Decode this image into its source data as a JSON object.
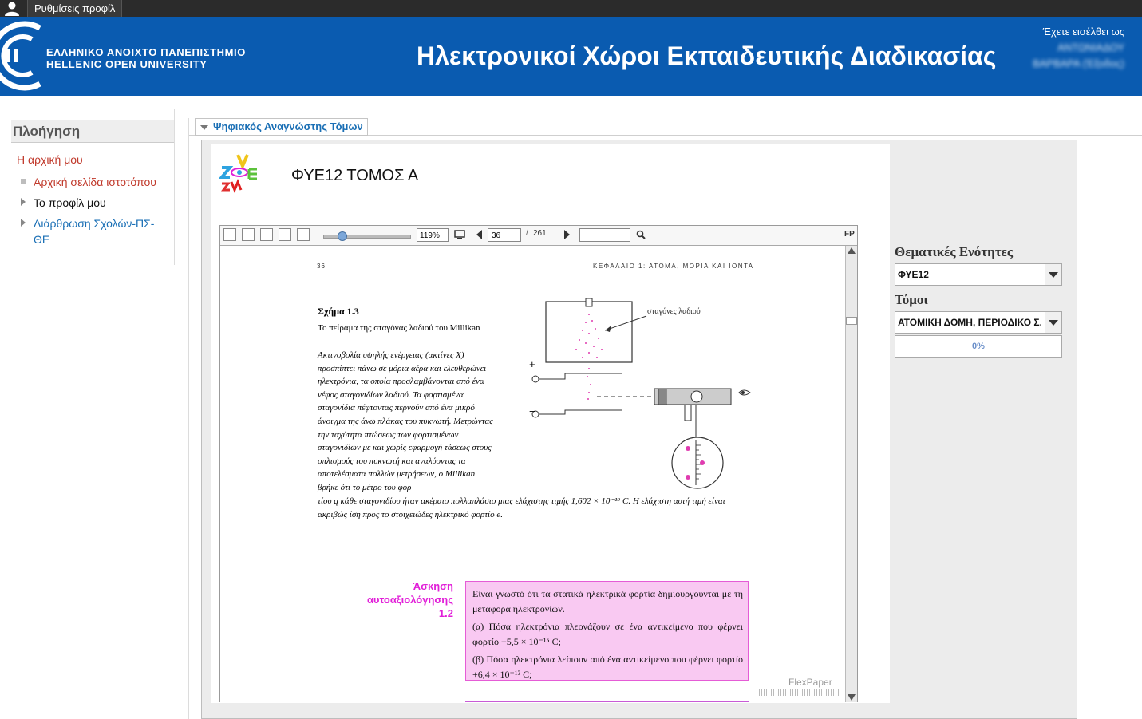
{
  "topbar": {
    "profile_settings": "Ρυθμίσεις προφίλ"
  },
  "banner": {
    "university_gr": "ΕΛΛΗΝΙΚΟ ΑΝΟΙΧΤΟ ΠΑΝΕΠΙΣΤΗΜΙΟ",
    "university_en": "HELLENIC OPEN UNIVERSITY",
    "title": "Ηλεκτρονικοί Χώροι Εκπαιδευτικής Διαδικασίας",
    "login_prefix": "Έχετε εισέλθει ως",
    "login_line2_blurred": "ΑΝΤΩΝΙΑΔΟΥ",
    "login_line3_blurred": "ΒΑΡΒΑΡΑ (Έξοδος)"
  },
  "nav": {
    "title": "Πλοήγηση",
    "home": "Η αρχική μου",
    "items": [
      {
        "label": "Αρχική σελίδα ιστοτόπου"
      },
      {
        "label": "Το προφίλ μου"
      },
      {
        "label": "Διάρθρωση Σχολών-ΠΣ-ΘΕ"
      }
    ]
  },
  "reader": {
    "legend": "Ψηφιακός Αναγνώστης Τόμων",
    "book_title": "ΦΥΕ12 ΤΟΜΟΣ Α",
    "toolbar": {
      "zoom": "119%",
      "current_page": "36",
      "page_sep": "/",
      "total_pages": "261",
      "fp": "FP"
    },
    "page": {
      "number": "36",
      "header": "ΚΕΦΑΛΑΙΟ 1: ΑΤΟΜΑ, ΜΟΡΙΑ ΚΑΙ ΙΟΝΤΑ",
      "figure_title": "Σχήμα 1.3",
      "figure_caption": "Το πείραμα της σταγόνας λαδιού του Millikan",
      "figure_text": "Ακτινοβολία υψηλής ενέργειας (ακτίνες Χ) προσπίπτει πάνω σε μόρια αέρα και ελευθερώνει ηλεκτρόνια, τα οποία προσλαμβάνονται από ένα νέφος σταγονιδίων λαδιού. Τα φορτισμένα σταγονίδια πέφτοντας περνούν από ένα μικρό άνοιγμα της άνω πλάκας του πυκνωτή. Μετρώντας την ταχύτητα πτώσεως των φορτισμένων σταγονιδίων με και χωρίς εφαρμογή τάσεως στους οπλισμούς του πυκνωτή και αναλύοντας τα αποτελέσματα πολλών μετρήσεων, ο Millikan βρήκε ότι το μέτρο του φορ-",
      "figure_text_cont": "τίου q κάθε σταγονιδίου ήταν ακέραιο πολλαπλάσιο μιας ελάχιστης τιμής 1,602 × 10⁻¹⁹ C. Η ελάχιστη αυτή τιμή είναι ακριβώς ίση προς το στοιχειώδες ηλεκτρικό φορτίο e.",
      "droplet_label": "σταγόνες λαδιού",
      "plus_sign": "+",
      "minus_sign": "−",
      "exercise_label_1": "Άσκηση",
      "exercise_label_2": "αυτοαξιολόγησης",
      "exercise_label_3": "1.2",
      "exercise_p1": "Είναι γνωστό ότι τα στατικά ηλεκτρικά φορτία δημιουργούνται με τη μεταφορά ηλεκτρονίων.",
      "exercise_p2": "(α) Πόσα ηλεκτρόνια πλεονάζουν σε ένα αντικείμενο που φέρνει φορτίο −5,5 × 10⁻¹⁵ C;",
      "exercise_p3": "(β) Πόσα ηλεκτρόνια λείπουν από ένα αντικείμενο που φέρνει φορτίο +6,4 × 10⁻¹² C;",
      "watermark": "FlexPaper"
    }
  },
  "side": {
    "units_label": "Θεματικές Ενότητες",
    "units_value": "ΦΥΕ12",
    "volumes_label": "Τόμοι",
    "volumes_value": "ΑΤΟΜΙΚΗ ΔΟΜΗ, ΠΕΡΙΟΔΙΚΟ Σ...",
    "progress_text": "0%"
  },
  "colors": {
    "banner": "#0a5bb0",
    "accent_magenta": "#e11ed8",
    "nav_home": "#c0392b",
    "link": "#1a6fb5"
  }
}
